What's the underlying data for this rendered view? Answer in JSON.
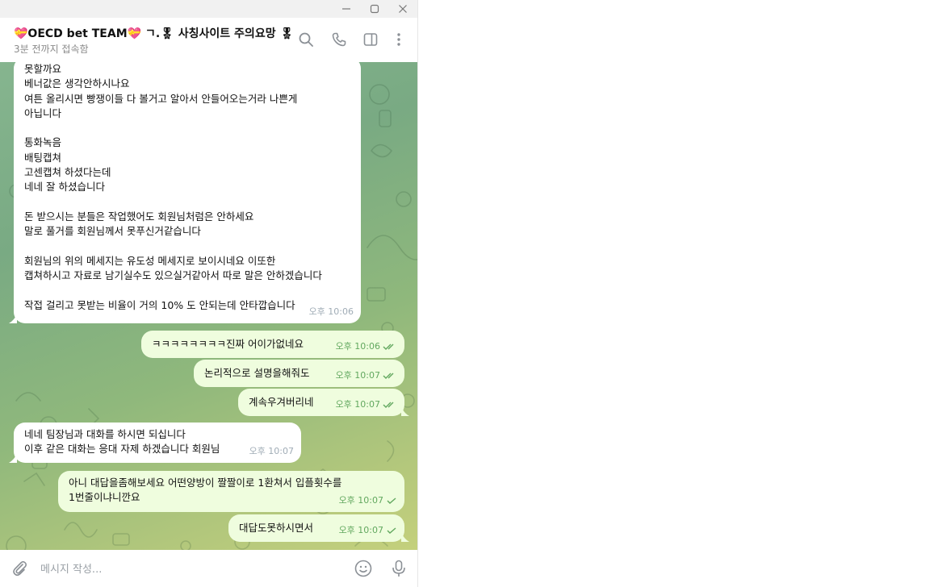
{
  "window": {
    "controls": [
      {
        "name": "minimize-icon"
      },
      {
        "name": "maximize-icon"
      },
      {
        "name": "close-icon"
      }
    ]
  },
  "header": {
    "title": "💝OECD bet TEAM💝 ㄱ.🎖 사칭사이트 주의요망 🎖",
    "status": "3분 전까지 접속함",
    "icons": [
      "search-icon",
      "phone-icon",
      "sidebar-toggle-icon",
      "more-vertical-icon"
    ]
  },
  "messages": [
    {
      "direction": "in",
      "text": "못할까요\n베너값은 생각안하시나요\n여튼 올리시면 빵쟁이들 다 볼거고 알아서 안들어오는거라 나쁜게\n아닙니다\n\n통화녹음\n배팅캡쳐\n고센캡쳐 하셨다는데\n네네 잘 하셨습니다\n\n돈 받으시는 분들은 작업했어도 회원님처럼은 안하세요\n말로 풀거를 회원님께서 못푸신거같습니다\n\n회원님의 위의 메세지는 유도성 메세지로 보이시네요 이또한\n캡쳐하시고 자료로 남기실수도 있으실거같아서 따로 말은 안하겠습니다\n\n작접 걸리고 못받는 비율이 거의 10% 도 안되는데 안타깝습니다",
      "time": "오후 10:06",
      "status": ""
    },
    {
      "direction": "out",
      "text": "ㅋㅋㅋㅋㅋㅋㅋㅋ진짜 어이가없네요",
      "time": "오후 10:06",
      "status": "read"
    },
    {
      "direction": "out",
      "text": "논리적으로 설명을해줘도",
      "time": "오후 10:07",
      "status": "read"
    },
    {
      "direction": "out",
      "text": "계속우겨버리네",
      "time": "오후 10:07",
      "status": "read"
    },
    {
      "direction": "in",
      "text": "네네 팀장님과 대화를 하시면 되십니다\n이후 같은 대화는 응대 자제 하겠습니다 회원님",
      "time": "오후 10:07",
      "status": ""
    },
    {
      "direction": "out",
      "text": "아니 대답을좀해보세요 어떤양방이 짤짤이로 1환쳐서 입플횟수를\n1번줄이냐니깐요",
      "time": "오후 10:07",
      "status": "sent"
    },
    {
      "direction": "out",
      "text": "대답도못하시면서",
      "time": "오후 10:07",
      "status": "sent"
    }
  ],
  "compose": {
    "placeholder": "메시지 작성...",
    "value": "",
    "icons": [
      "attach-icon",
      "emoji-icon",
      "microphone-icon"
    ]
  },
  "colors": {
    "incoming_bubble": "#ffffff",
    "outgoing_bubble": "#effdde",
    "check_color": "#62a85f",
    "chat_bg_top": "#86b58f",
    "chat_bg_bottom": "#c4d07c"
  }
}
